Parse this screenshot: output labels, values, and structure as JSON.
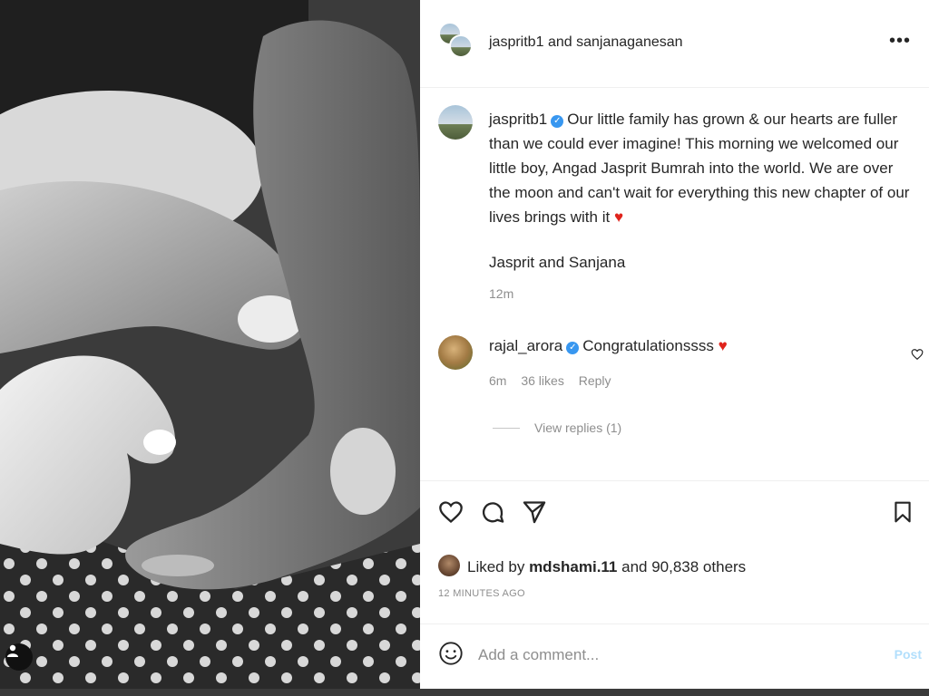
{
  "post": {
    "header_user1": "jaspritb1",
    "header_and": "and",
    "header_user2": "sanjanaganesan",
    "more_label": "•••"
  },
  "caption": {
    "user": "jaspritb1",
    "text": "Our little family has grown & our hearts are fuller than we could ever imagine! This morning we welcomed our little boy, Angad Jasprit Bumrah into the world. We are over the moon and can't wait for everything this new chapter of our lives brings with it",
    "heart": "♥",
    "signoff": "Jasprit and Sanjana",
    "time": "12m"
  },
  "comment": {
    "user": "rajal_arora",
    "text": "Congratulationssss",
    "heart": "♥",
    "time": "6m",
    "likes": "36 likes",
    "reply_label": "Reply",
    "view_replies": "View replies (1)"
  },
  "likes": {
    "prefix": "Liked by",
    "user": "mdshami.11",
    "suffix": "and 90,838 others",
    "post_time": "12 MINUTES AGO"
  },
  "comment_box": {
    "placeholder": "Add a comment...",
    "post_label": "Post"
  },
  "colors": {
    "verified": "#3897f0",
    "heart": "#e0241c",
    "post_button": "#b2dffc"
  },
  "icons": {
    "like": "heart-outline-icon",
    "comment": "comment-bubble-icon",
    "share": "paper-plane-icon",
    "save": "bookmark-icon",
    "emoji": "smiley-icon",
    "tag": "user-tag-icon"
  }
}
